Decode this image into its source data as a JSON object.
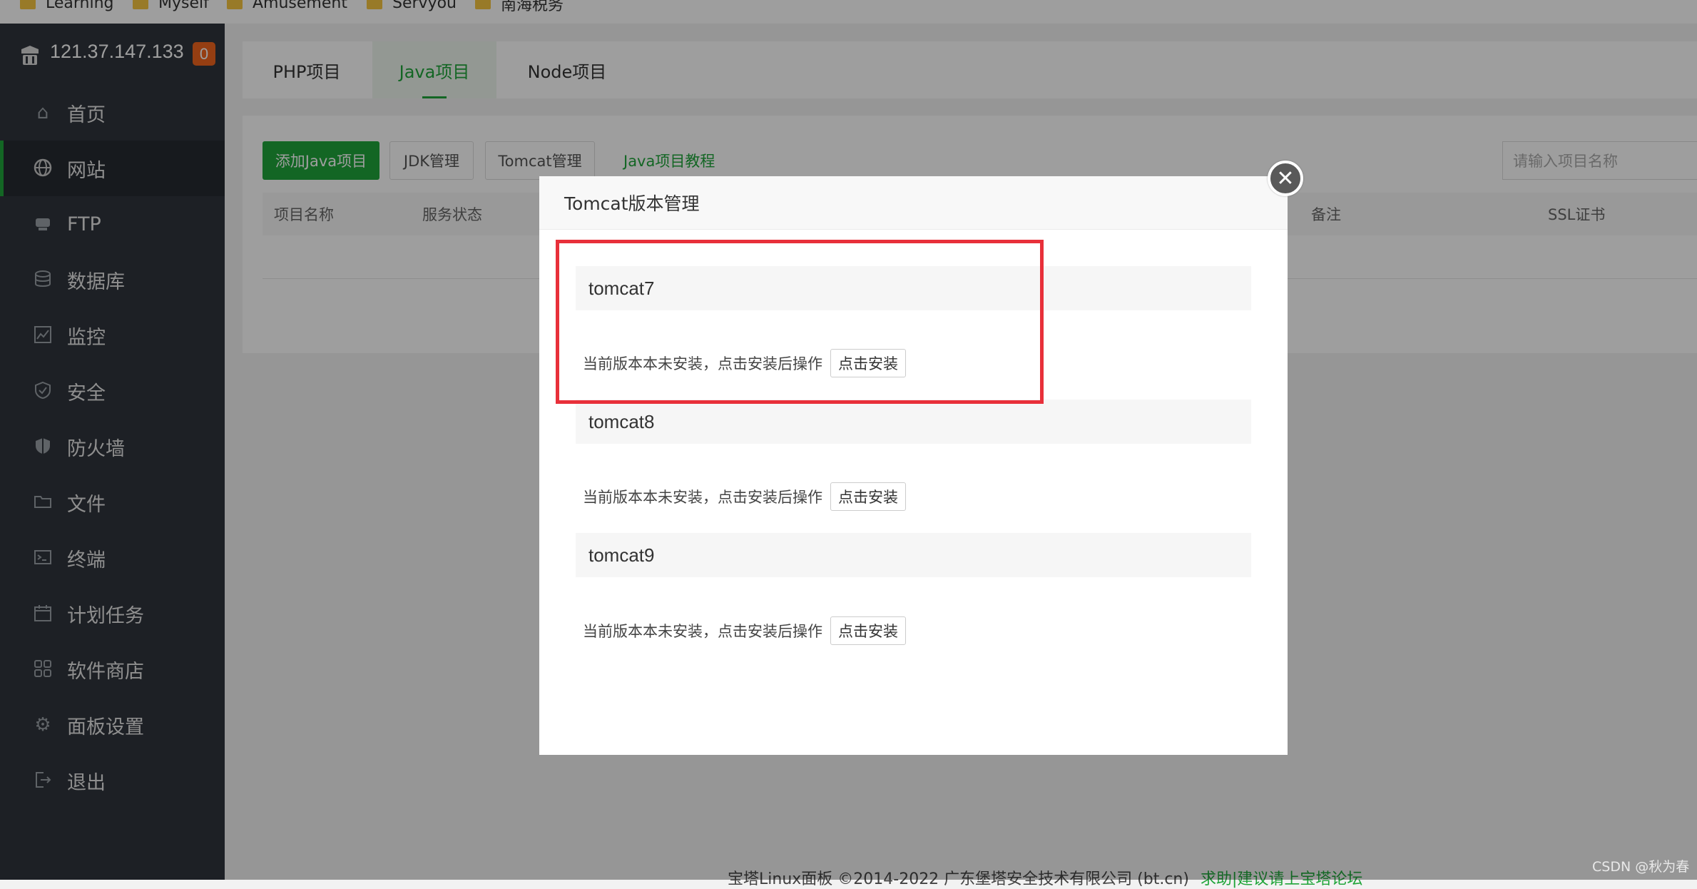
{
  "bookmarks": [
    "Learning",
    "Myself",
    "Amusement",
    "Servyou",
    "南海税务"
  ],
  "sidebar": {
    "server_ip": "121.37.147.133",
    "badge_count": "0",
    "items": [
      {
        "label": "首页",
        "icon": "home-icon"
      },
      {
        "label": "网站",
        "icon": "globe-icon",
        "active": true
      },
      {
        "label": "FTP",
        "icon": "ftp-icon"
      },
      {
        "label": "数据库",
        "icon": "database-icon"
      },
      {
        "label": "监控",
        "icon": "monitor-icon"
      },
      {
        "label": "安全",
        "icon": "shield-icon"
      },
      {
        "label": "防火墙",
        "icon": "firewall-icon"
      },
      {
        "label": "文件",
        "icon": "folder-icon"
      },
      {
        "label": "终端",
        "icon": "terminal-icon"
      },
      {
        "label": "计划任务",
        "icon": "calendar-icon"
      },
      {
        "label": "软件商店",
        "icon": "grid-icon"
      },
      {
        "label": "面板设置",
        "icon": "gear-icon"
      },
      {
        "label": "退出",
        "icon": "logout-icon"
      }
    ]
  },
  "tabs": [
    {
      "label": "PHP项目"
    },
    {
      "label": "Java项目",
      "active": true
    },
    {
      "label": "Node项目"
    }
  ],
  "toolbar": {
    "add_java": "添加Java项目",
    "jdk": "JDK管理",
    "tomcat": "Tomcat管理",
    "tutorial": "Java项目教程",
    "search_placeholder": "请输入项目名称"
  },
  "table": {
    "headers": [
      "项目名称",
      "服务状态",
      "备注",
      "SSL证书"
    ]
  },
  "footer": {
    "copyright": "宝塔Linux面板 ©2014-2022 广东堡塔安全技术有限公司 (bt.cn)",
    "link": "求助|建议请上宝塔论坛"
  },
  "watermark": "CSDN @秋为春",
  "modal": {
    "title": "Tomcat版本管理",
    "versions": [
      {
        "name": "tomcat7",
        "status": "当前版本本未安装，点击安装后操作",
        "button": "点击安装"
      },
      {
        "name": "tomcat8",
        "status": "当前版本本未安装，点击安装后操作",
        "button": "点击安装"
      },
      {
        "name": "tomcat9",
        "status": "当前版本本未安装，点击安装后操作",
        "button": "点击安装"
      }
    ]
  },
  "colors": {
    "accent": "#20a53a",
    "highlight": "#e8303a",
    "badge": "#f0641e",
    "sidebar": "#30353c"
  }
}
